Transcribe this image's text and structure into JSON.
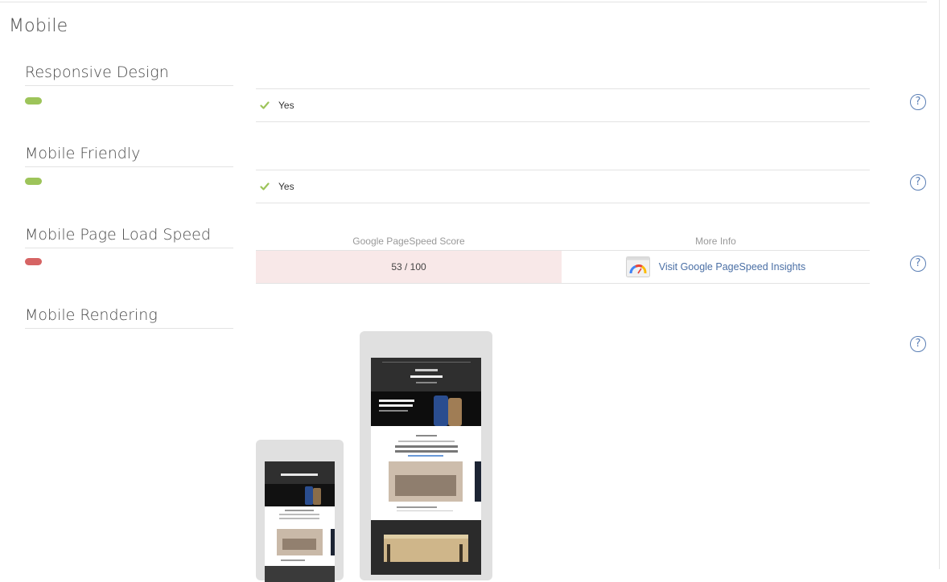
{
  "section": {
    "title": "Mobile"
  },
  "checks": {
    "responsive": {
      "label": "Responsive Design",
      "status": "pass",
      "result": "Yes"
    },
    "friendly": {
      "label": "Mobile Friendly",
      "status": "pass",
      "result": "Yes"
    },
    "speed": {
      "label": "Mobile Page Load Speed",
      "status": "fail",
      "col_score": "Google PageSpeed Score",
      "col_info": "More Info",
      "score": "53 / 100",
      "link_text": "Visit Google PageSpeed Insights"
    },
    "rendering": {
      "label": "Mobile Rendering"
    }
  },
  "help": {
    "glyph": "?"
  },
  "colors": {
    "pass": "#9dc45a",
    "fail": "#d66464",
    "link": "#4a6fa5",
    "score_bg": "#f8e8e8"
  },
  "icons": [
    "check-icon",
    "help-circle-icon",
    "pagespeed-gauge-icon"
  ]
}
